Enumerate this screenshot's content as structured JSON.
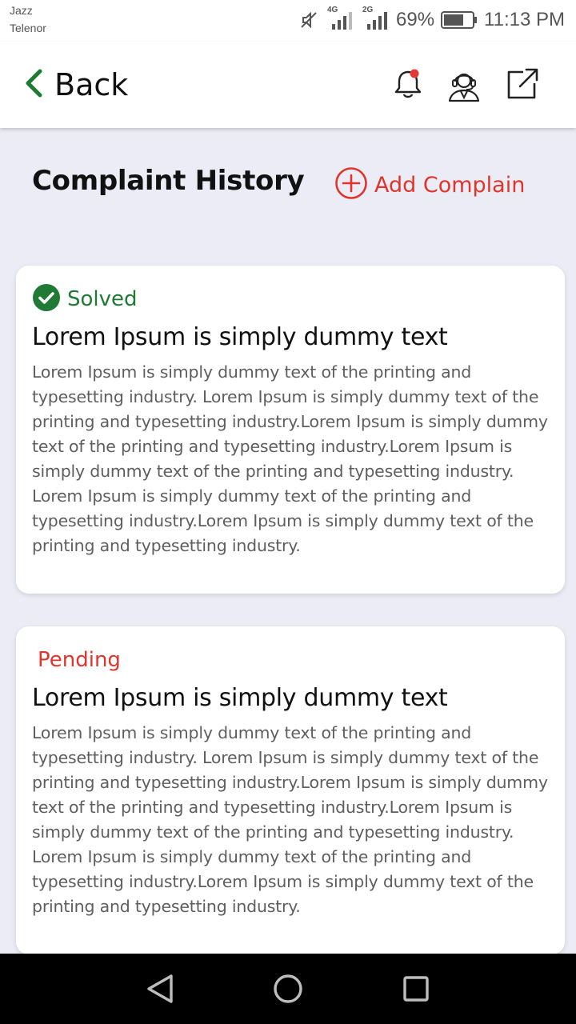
{
  "status_bar": {
    "carrier_1": "Jazz",
    "carrier_2": "Telenor",
    "network_1": "4G",
    "network_2": "2G",
    "battery": "69%",
    "time": "11:13 PM"
  },
  "header": {
    "back_label": "Back",
    "icons": [
      "bell-icon",
      "support-agent-icon",
      "external-link-icon"
    ],
    "notification_dot_color": "#e53935",
    "back_chevron_color": "#1e7a35"
  },
  "page": {
    "title": "Complaint History",
    "add_label": "Add Complain",
    "accent_color": "#e0352b"
  },
  "complaints": [
    {
      "status": "Solved",
      "status_color": "#1e7a35",
      "title": "Lorem Ipsum is simply dummy text",
      "body": "Lorem Ipsum is simply dummy text of the printing and typesetting industry. Lorem Ipsum is simply dummy text of the printing and typesetting industry.Lorem Ipsum is simply dummy text of the printing and typesetting industry.Lorem Ipsum is simply dummy text of the printing and typesetting industry. Lorem Ipsum is simply dummy text of the printing and typesetting industry.Lorem Ipsum is simply dummy text of the printing and typesetting industry."
    },
    {
      "status": "Pending",
      "status_color": "#e0352b",
      "title": "Lorem Ipsum is simply dummy text",
      "body": "Lorem Ipsum is simply dummy text of the printing and typesetting industry. Lorem Ipsum is simply dummy text of the printing and typesetting industry.Lorem Ipsum is simply dummy text of the printing and typesetting industry.Lorem Ipsum is simply dummy text of the printing and typesetting industry. Lorem Ipsum is simply dummy text of the printing and typesetting industry.Lorem Ipsum is simply dummy text of the printing and typesetting industry."
    }
  ],
  "nav_bar": {
    "buttons": [
      "back-triangle-icon",
      "home-circle-icon",
      "recents-square-icon"
    ]
  }
}
